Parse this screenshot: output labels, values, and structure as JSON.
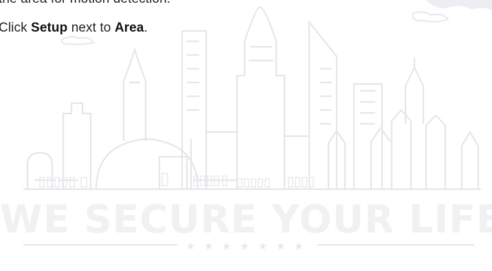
{
  "instructions": {
    "line1": "the area for motion detection.",
    "line2_prefix": "Click ",
    "line2_action": "Setup",
    "line2_middle": "  next to ",
    "line2_target": "Area",
    "line2_suffix": "."
  },
  "watermark": {
    "text": "WE SECURE YOUR LIFE",
    "stars": "★ ★ ★ ★ ★ ★ ★",
    "colors": {
      "line": "#e8e8ec",
      "fill": "#f1f1f3",
      "cloud": "#ececf0"
    }
  }
}
